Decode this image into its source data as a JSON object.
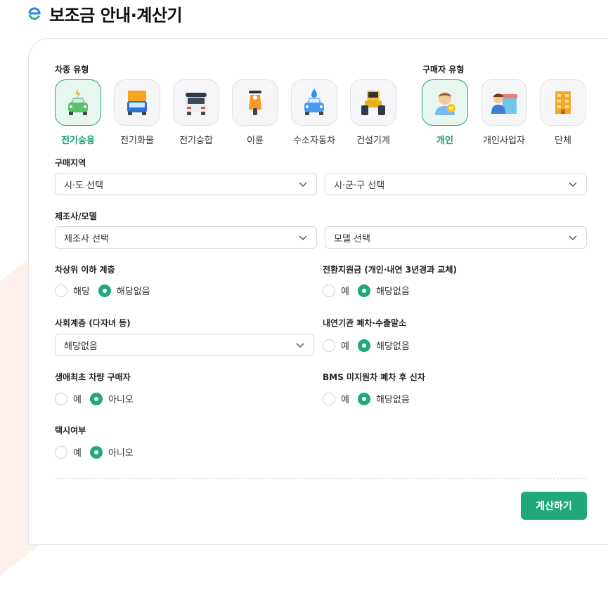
{
  "page": {
    "title": "보조금 안내·계산기"
  },
  "vehicle_type": {
    "label": "차종 유형",
    "options": [
      {
        "name": "전기승용",
        "icon": "ev-car-icon",
        "selected": true
      },
      {
        "name": "전기화물",
        "icon": "truck-icon",
        "selected": false
      },
      {
        "name": "전기승합",
        "icon": "van-icon",
        "selected": false
      },
      {
        "name": "이륜",
        "icon": "scooter-icon",
        "selected": false
      },
      {
        "name": "수소자동차",
        "icon": "hydrogen-car-icon",
        "selected": false
      },
      {
        "name": "건설기계",
        "icon": "construction-vehicle-icon",
        "selected": false
      }
    ]
  },
  "buyer_type": {
    "label": "구매자 유형",
    "options": [
      {
        "name": "개인",
        "icon": "person-icon",
        "selected": true
      },
      {
        "name": "개인사업자",
        "icon": "shop-owner-icon",
        "selected": false
      },
      {
        "name": "단체",
        "icon": "building-icon",
        "selected": false
      }
    ]
  },
  "region": {
    "label": "구매지역",
    "sido": "시·도 선택",
    "sigungu": "시·군·구 선택"
  },
  "maker_model": {
    "label": "제조사/모델",
    "maker": "제조사 선택",
    "model": "모델 선택"
  },
  "low_income": {
    "label": "차상위 이하 계층",
    "options": [
      "해당",
      "해당없음"
    ],
    "selected": 1
  },
  "transition": {
    "label": "전환지원금 (개인·내연 3년경과 교체)",
    "options": [
      "예",
      "해당없음"
    ],
    "selected": 1
  },
  "social_class": {
    "label": "사회계층 (다자녀 등)",
    "value": "해당없음"
  },
  "ice_scrap": {
    "label": "내연기관 폐차·수출말소",
    "options": [
      "예",
      "해당없음"
    ],
    "selected": 1
  },
  "first_buyer": {
    "label": "생애최초 차량 구매자",
    "options": [
      "예",
      "아니오"
    ],
    "selected": 1
  },
  "bms": {
    "label": "BMS 미지원차 폐차 후 신차",
    "options": [
      "예",
      "해당없음"
    ],
    "selected": 1
  },
  "taxi": {
    "label": "택시여부",
    "options": [
      "예",
      "아니오"
    ],
    "selected": 1
  },
  "calculate_button": "계산하기",
  "colors": {
    "accent": "#1fa87a",
    "selected_bg": "#e7f7ef",
    "icon_bg": "#f6f6f8"
  }
}
